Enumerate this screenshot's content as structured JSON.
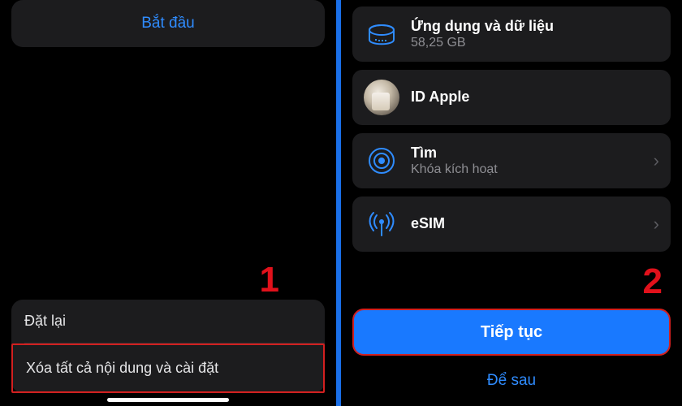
{
  "left": {
    "start_label": "Bắt đầu",
    "reset_label": "Đặt lại",
    "erase_label": "Xóa tất cả nội dung và cài đặt",
    "annotation": "1"
  },
  "right": {
    "items": [
      {
        "title": "Ứng dụng và dữ liệu",
        "subtitle": "58,25 GB",
        "icon": "storage",
        "chevron": false
      },
      {
        "title": "ID Apple",
        "subtitle": "",
        "icon": "avatar",
        "chevron": false
      },
      {
        "title": "Tìm",
        "subtitle": "Khóa kích hoạt",
        "icon": "findmy",
        "chevron": true
      },
      {
        "title": "eSIM",
        "subtitle": "",
        "icon": "cellular",
        "chevron": true
      }
    ],
    "continue_label": "Tiếp tục",
    "later_label": "Để sau",
    "annotation": "2"
  }
}
